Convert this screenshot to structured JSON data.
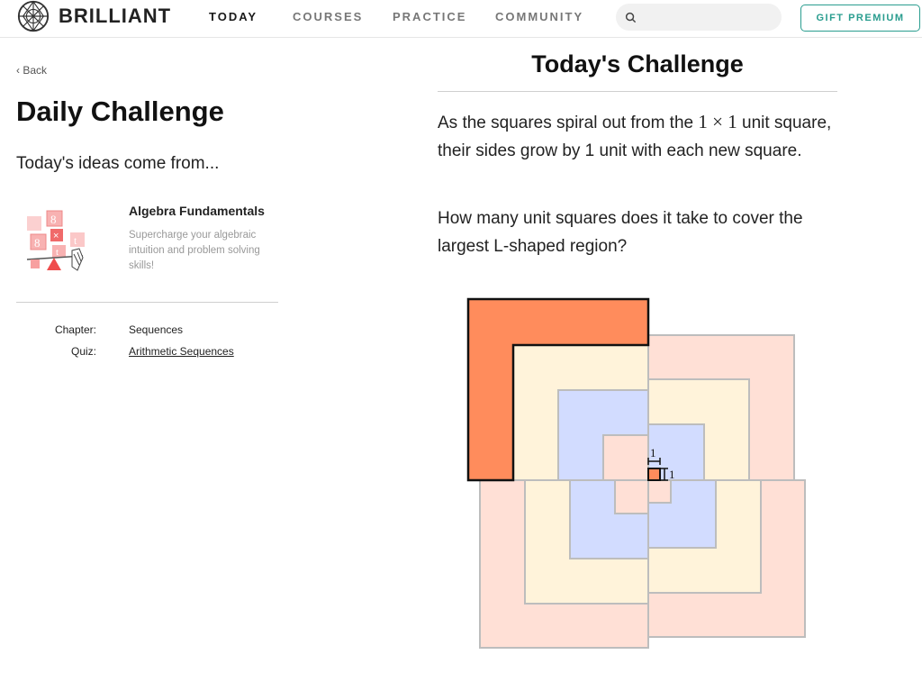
{
  "app": {
    "logo_text": "BRILLIANT"
  },
  "nav": {
    "links": [
      {
        "label": "TODAY",
        "active": true
      },
      {
        "label": "COURSES",
        "active": false
      },
      {
        "label": "PRACTICE",
        "active": false
      },
      {
        "label": "COMMUNITY",
        "active": false
      }
    ],
    "search_placeholder": "",
    "gift_label": "GIFT PREMIUM"
  },
  "sidebar": {
    "back_label": "‹ Back",
    "title": "Daily Challenge",
    "subtitle": "Today's ideas come from...",
    "course": {
      "name": "Algebra Fundamentals",
      "description": "Supercharge your algebraic intuition and problem solving skills!"
    },
    "meta": [
      {
        "label": "Chapter:",
        "value": "Sequences",
        "link": false
      },
      {
        "label": "Quiz:",
        "value": "Arithmetic Sequences",
        "link": true
      }
    ]
  },
  "main": {
    "title": "Today's Challenge",
    "para1_before": "As the squares spiral out from the ",
    "para1_math": "1 × 1",
    "para1_after": " unit square, their sides grow by 1 unit with each new square.",
    "para2": "How many unit squares does it take to cover the largest L-shaped region?",
    "figure_labels": {
      "top": "1",
      "side": "1"
    }
  },
  "colors": {
    "accent": "#2a9d8f",
    "highlight_orange": "#ff8c5c",
    "salmon": "#ffe0d6",
    "cream": "#fff3da",
    "blue": "#d2dcff",
    "outline": "#bdbdbd"
  }
}
